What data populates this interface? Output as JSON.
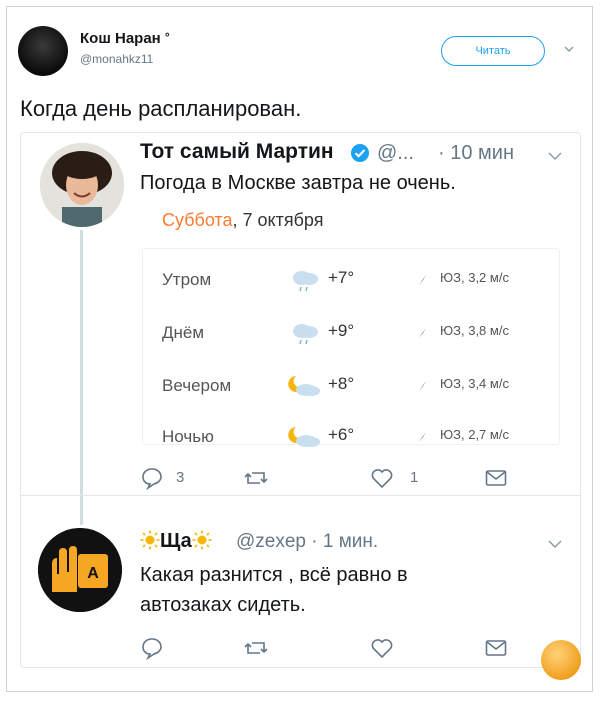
{
  "header": {
    "author_name": "Кош Наран",
    "author_mark": "°",
    "author_handle": "@monahkz11",
    "follow_label": "Читать"
  },
  "tweet": {
    "text": "Когда день распланирован."
  },
  "reply1": {
    "name": "Тот самый Мартин",
    "handle": "@...",
    "time": "· 10 мин",
    "text": "Погода в Москве завтра не очень.",
    "weather": {
      "date_day": "Суббота",
      "date_rest": ", 7 октября",
      "rows": [
        {
          "label": "Утром",
          "icon": "rain-cloud-icon",
          "temp": "+7°",
          "wind": "ЮЗ, 3,2 м/с"
        },
        {
          "label": "Днём",
          "icon": "rain-cloud-icon",
          "temp": "+9°",
          "wind": "ЮЗ, 3,8 м/с"
        },
        {
          "label": "Вечером",
          "icon": "moon-cloud-icon",
          "temp": "+8°",
          "wind": "ЮЗ, 3,4 м/с"
        },
        {
          "label": "Ночью",
          "icon": "moon-cloud-icon",
          "temp": "+6°",
          "wind": "ЮЗ, 2,7 м/с"
        }
      ]
    },
    "actions": {
      "reply_count": "3",
      "like_count": "1"
    }
  },
  "reply2": {
    "name_suffix": "Ща",
    "meta": "@zexep · 1 мин.",
    "text_line1": "Какая разнится , всё равно в",
    "text_line2": "автозаках сидеть.",
    "avatar_letter": "A"
  },
  "colors": {
    "accent": "#1da1f2",
    "date_accent": "#ff7a2f",
    "sun": "#f5b50a"
  }
}
